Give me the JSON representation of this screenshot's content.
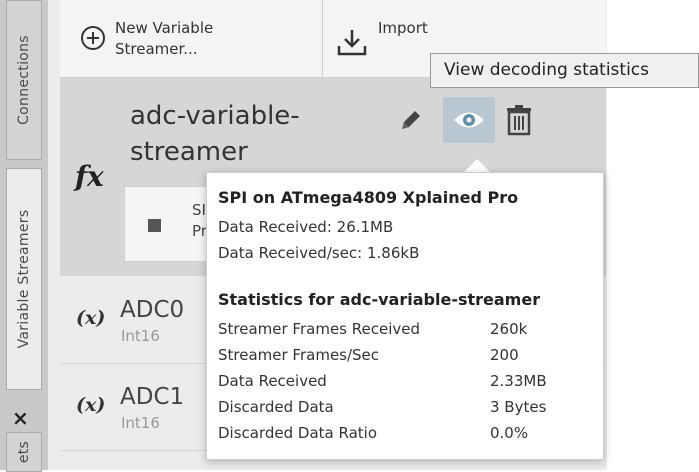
{
  "tabs": {
    "connections": "Connections",
    "variable_streamers": "Variable Streamers",
    "close": "×",
    "bottom": "ets"
  },
  "toolbar": {
    "new_label": "New Variable Streamer...",
    "import_label": "Import Variable Strea"
  },
  "streamer": {
    "name": "adc-variable-streamer",
    "fx_label": "fx",
    "box_text": "SI Pr"
  },
  "tooltip": {
    "text": "View decoding statistics"
  },
  "variables": [
    {
      "prefix": "(x)",
      "name": "ADC0",
      "type": "Int16"
    },
    {
      "prefix": "(x)",
      "name": "ADC1",
      "type": "Int16"
    }
  ],
  "stats": {
    "connection_title": "SPI on ATmega4809 Xplained Pro",
    "data_received": "Data Received: 26.1MB",
    "data_rate": "Data Received/sec: 1.86kB",
    "streamer_title": "Statistics for adc-variable-streamer",
    "rows": [
      {
        "label": "Streamer Frames Received",
        "value": "260k"
      },
      {
        "label": "Streamer Frames/Sec",
        "value": "200"
      },
      {
        "label": "Data Received",
        "value": "2.33MB"
      },
      {
        "label": "Discarded Data",
        "value": "3 Bytes"
      },
      {
        "label": "Discarded Data Ratio",
        "value": "0.0%"
      }
    ]
  },
  "colors": {
    "accent_eye": "#5e8fb0",
    "eye_bg": "#b9c7d0",
    "panel_bg": "#ececec"
  }
}
